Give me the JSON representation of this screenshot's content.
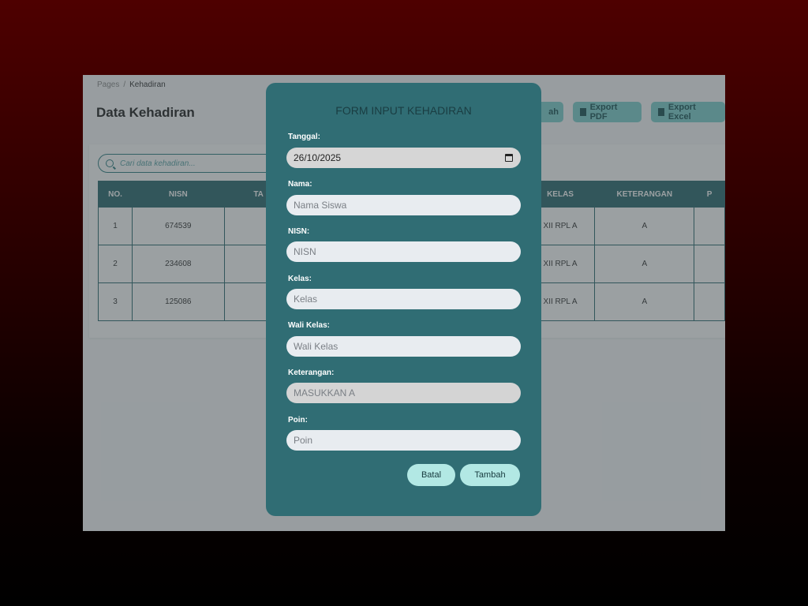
{
  "breadcrumb": {
    "root": "Pages",
    "separator": "/",
    "current": "Kehadiran"
  },
  "page_title": "Data Kehadiran",
  "toolbar": {
    "add_partial": "ah",
    "export_pdf": "Export PDF",
    "export_excel": "Export Excel"
  },
  "search": {
    "placeholder": "Cari data kehadiran..."
  },
  "table": {
    "headers": [
      "NO.",
      "NISN",
      "TA",
      "",
      "",
      "",
      "KELAS",
      "KETERANGAN",
      "P"
    ],
    "rows": [
      [
        "1",
        "674539",
        "",
        "",
        "",
        "",
        "XII RPL A",
        "A",
        ""
      ],
      [
        "2",
        "234608",
        "",
        "",
        "",
        "",
        "XII RPL A",
        "A",
        ""
      ],
      [
        "3",
        "125086",
        "",
        "",
        "",
        "",
        "XII RPL A",
        "A",
        ""
      ]
    ]
  },
  "modal": {
    "title": "FORM INPUT KEHADIRAN",
    "fields": {
      "tanggal": {
        "label": "Tanggal:",
        "value": "26/10/2025"
      },
      "nama": {
        "label": "Nama:",
        "placeholder": "Nama Siswa"
      },
      "nisn": {
        "label": "NISN:",
        "placeholder": "NISN"
      },
      "kelas": {
        "label": "Kelas:",
        "placeholder": "Kelas"
      },
      "wali_kelas": {
        "label": "Wali Kelas:",
        "placeholder": "Wali Kelas"
      },
      "keterangan": {
        "label": "Keterangan:",
        "value": "MASUKKAN A"
      },
      "poin": {
        "label": "Poin:",
        "placeholder": "Poin"
      }
    },
    "cancel_label": "Batal",
    "submit_label": "Tambah"
  }
}
